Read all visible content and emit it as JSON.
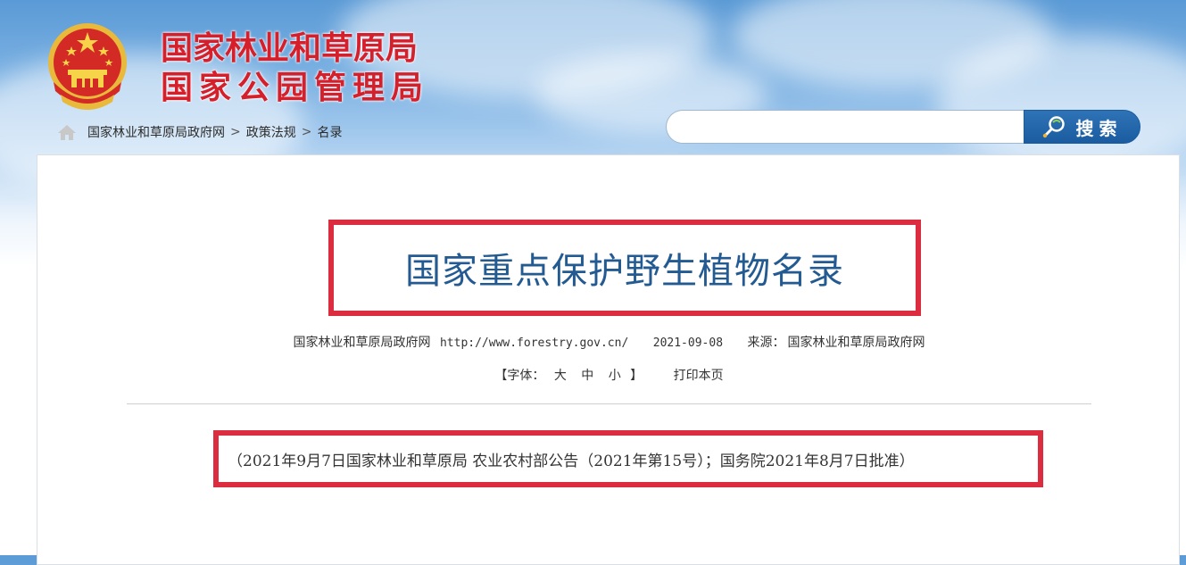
{
  "header": {
    "agency_line1": "国家林业和草原局",
    "agency_line2": "国家公园管理局",
    "emblem_icon": "national-emblem-icon"
  },
  "breadcrumb": {
    "home_icon": "home-icon",
    "items": [
      "国家林业和草原局政府网",
      "政策法规",
      "名录"
    ],
    "separator": ">"
  },
  "search": {
    "placeholder": "",
    "value": "",
    "button_label": "搜索",
    "button_icon": "search-icon",
    "button_color": "#1f63a8"
  },
  "article": {
    "title": "国家重点保护野生植物名录",
    "meta": {
      "site": "国家林业和草原局政府网",
      "url": "http://www.forestry.gov.cn/",
      "date": "2021-09-08",
      "source_label": "来源：",
      "source": "国家林业和草原局政府网"
    },
    "font_size_control": {
      "open_bracket": "【字体：",
      "options": [
        "大",
        "中",
        "小"
      ],
      "close_bracket": "】"
    },
    "print_label": "打印本页",
    "notice": "（2021年9月7日国家林业和草原局 农业农村部公告（2021年第15号）；国务院2021年8月7日批准）"
  },
  "colors": {
    "highlight_border": "#dc2c3f",
    "title_text": "#225a91",
    "brand_red": "#d51f2b"
  }
}
